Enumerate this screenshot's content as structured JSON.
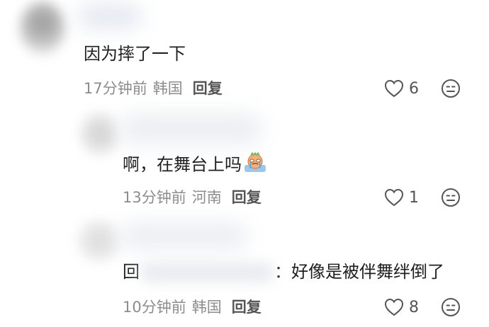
{
  "comments": [
    {
      "text": "因为摔了一下",
      "time": "17分钟前",
      "location": "韩国",
      "reply_label": "回复",
      "likes": "6"
    },
    {
      "text": "啊，在舞台上吗",
      "time": "13分钟前",
      "location": "河南",
      "reply_label": "回复",
      "likes": "1"
    },
    {
      "text_prefix": "回",
      "text_suffix": "：好像是被伴舞绊倒了",
      "time": "10分钟前",
      "location": "韩国",
      "reply_label": "回复",
      "likes": "8"
    }
  ],
  "icons": {
    "like": "heart-outline-icon",
    "dislike": "meh-face-icon",
    "sticker": "crying-sticker-icon"
  },
  "colors": {
    "meta_text": "#8c8c8c",
    "reply_text": "#555555",
    "icon_stroke": "#555555"
  }
}
